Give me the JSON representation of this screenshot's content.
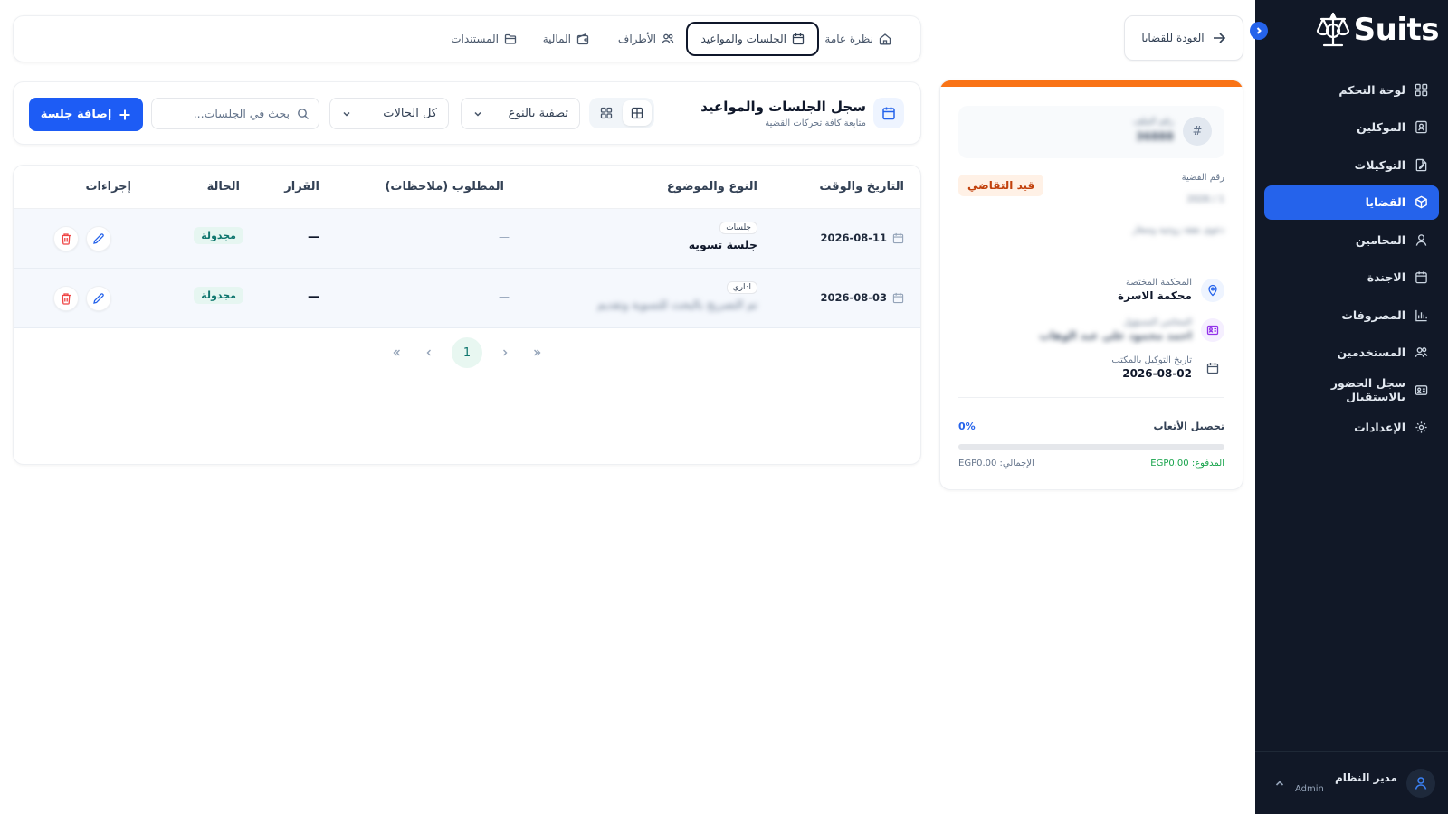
{
  "brand": {
    "name": "Suits"
  },
  "sidebar": {
    "items": [
      {
        "label": "لوحة التحكم",
        "icon": "dashboard-icon",
        "active": false
      },
      {
        "label": "الموكلين",
        "icon": "contacts-icon",
        "active": false
      },
      {
        "label": "التوكيلات",
        "icon": "document-edit-icon",
        "active": false
      },
      {
        "label": "القضايا",
        "icon": "box-icon",
        "active": true
      },
      {
        "label": "المحامين",
        "icon": "user-icon",
        "active": false
      },
      {
        "label": "الاجندة",
        "icon": "calendar-icon",
        "active": false
      },
      {
        "label": "المصروفات",
        "icon": "bar-chart-icon",
        "active": false
      },
      {
        "label": "المستخدمين",
        "icon": "users-icon",
        "active": false
      },
      {
        "label": "سجل الحضور بالاستقبال",
        "icon": "id-card-icon",
        "active": false
      },
      {
        "label": "الإعدادات",
        "icon": "gear-icon",
        "active": false
      }
    ],
    "user": {
      "name": "مدير النظام",
      "role": "Admin"
    }
  },
  "topbar": {
    "back_label": "العودة للقضايا"
  },
  "tabs": [
    {
      "label": "نظرة عامة",
      "icon": "home-icon",
      "active": false
    },
    {
      "label": "الجلسات والمواعيد",
      "icon": "calendar-icon",
      "active": true
    },
    {
      "label": "الأطراف",
      "icon": "users-icon",
      "active": false
    },
    {
      "label": "المالية",
      "icon": "wallet-icon",
      "active": false
    },
    {
      "label": "المستندات",
      "icon": "folder-icon",
      "active": false
    }
  ],
  "case_card": {
    "file_label": "رقم الملف",
    "file_value": "36888",
    "case_number_label": "رقم القضية",
    "case_number_value": "2026 / 1",
    "status": "قيد التقاضي",
    "case_type": "دعوى نفقة زوجية وصغار",
    "court_label": "المحكمة المختصة",
    "court_value": "محكمة الاسرة",
    "lawyer_label": "المحامي المسؤول",
    "lawyer_value": "احمد محمود علي عبد الوهاب",
    "poa_date_label": "تاريخ التوكيل بالمكتب",
    "poa_date_value": "2026-08-02",
    "fees_label": "تحصيل الأتعاب",
    "fees_percent": "0%",
    "fees_progress": 0,
    "paid": "المدفوع: EGP0.00",
    "total": "الإجمالي: EGP0.00"
  },
  "sessions": {
    "title": "سجل الجلسات والمواعيد",
    "subtitle": "متابعة كافة تحركات القضية",
    "type_filter": "تصفية بالنوع",
    "status_filter": "كل الحالات",
    "search_placeholder": "بحث في الجلسات...",
    "add_label": "إضافة جلسة",
    "columns": [
      "التاريخ والوقت",
      "النوع والموضوع",
      "المطلوب (ملاحظات)",
      "القرار",
      "الحالة",
      "إجراءات"
    ],
    "rows": [
      {
        "date": "2026-08-11",
        "type": "جلسات",
        "subject": "جلسة تسويه",
        "required": "—",
        "decision": "—",
        "status": "مجدولة",
        "blurred": false
      },
      {
        "date": "2026-08-03",
        "type": "اداري",
        "subject": "تم التصريح بالبحث للتسوية وتقديم",
        "required": "—",
        "decision": "—",
        "status": "مجدولة",
        "blurred": true
      }
    ],
    "pagination": {
      "current": "1"
    }
  }
}
